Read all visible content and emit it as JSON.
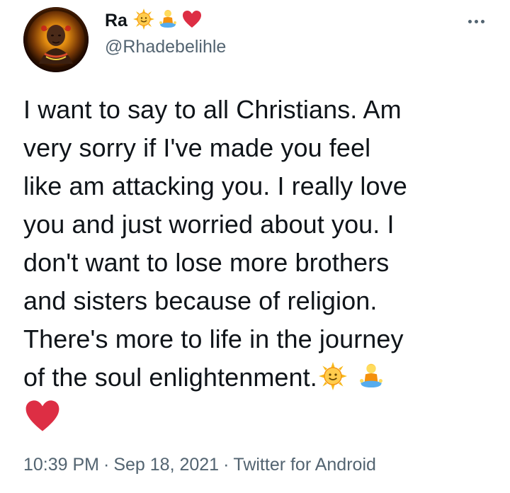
{
  "author": {
    "display_name": "Ra",
    "handle": "@Rhadebelihle",
    "name_emojis": [
      "sun-face-icon",
      "person-in-lotus-position-icon",
      "red-heart-icon"
    ]
  },
  "tweet": {
    "lines": [
      "I want to say to all Christians. Am",
      "very sorry if I've made you feel",
      "like am attacking you. I really love",
      "you and just worried about you. I",
      "don't want to lose more brothers",
      "and sisters because of religion.",
      "There's more to life in the journey",
      "of the soul enlightenment."
    ],
    "trailing_emojis": [
      "sun-face-icon",
      "person-in-lotus-position-icon",
      "red-heart-icon"
    ]
  },
  "meta": {
    "time": "10:39 PM",
    "separator": "·",
    "date": "Sep 18, 2021",
    "source": "Twitter for Android"
  },
  "colors": {
    "text": "#0f1419",
    "secondary": "#536471",
    "heart": "#e0245e",
    "sun": "#f7b91c"
  }
}
